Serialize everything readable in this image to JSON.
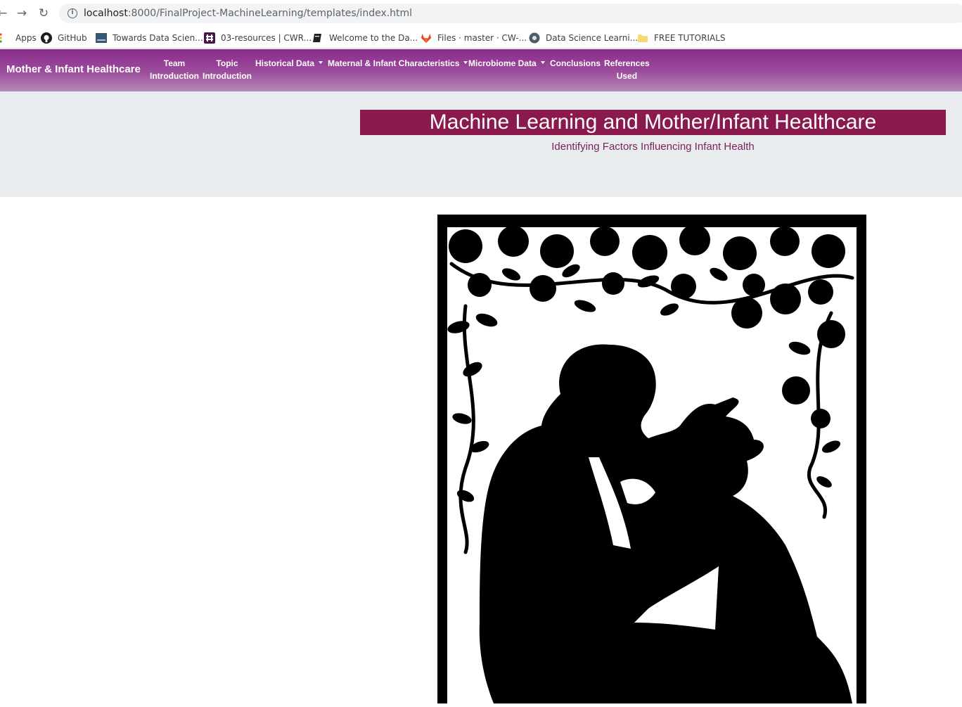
{
  "browser": {
    "url_host": "localhost",
    "url_rest": ":8000/FinalProject-MachineLearning/templates/index.html",
    "bookmarks": [
      {
        "label": "Apps",
        "icon": "apps-grid-icon"
      },
      {
        "label": "GitHub",
        "icon": "github-icon"
      },
      {
        "label": "Towards Data Scien...",
        "icon": "towards-data-science-icon"
      },
      {
        "label": "03-resources | CWR...",
        "icon": "slack-icon"
      },
      {
        "label": "Welcome to the Da...",
        "icon": "book-icon"
      },
      {
        "label": "Files · master · CW-...",
        "icon": "gitlab-icon"
      },
      {
        "label": "Data Science Learni...",
        "icon": "site-globe-icon"
      },
      {
        "label": "FREE TUTORIALS",
        "icon": "folder-icon"
      }
    ]
  },
  "navbar": {
    "brand": "Mother & Infant Healthcare",
    "items": [
      {
        "line1": "Team",
        "line2": "Introduction"
      },
      {
        "line1": "Topic",
        "line2": "Introduction"
      },
      {
        "label": "Historical Data"
      },
      {
        "label": "Maternal & Infant Characteristics"
      },
      {
        "label": "Microbiome Data"
      },
      {
        "label": "Conclusions"
      },
      {
        "line1": "References",
        "line2": "Used"
      }
    ]
  },
  "hero": {
    "title": "Machine Learning and Mother/Infant Healthcare",
    "subtitle": "Identifying Factors Influencing Infant Health"
  },
  "colors": {
    "navbar_top": "#8a2a8c",
    "navbar_bottom": "#b58ab8",
    "title_bar": "#8a1a4d",
    "subtitle_text": "#7c1f5a",
    "jumbotron_bg": "#e9ecef"
  }
}
